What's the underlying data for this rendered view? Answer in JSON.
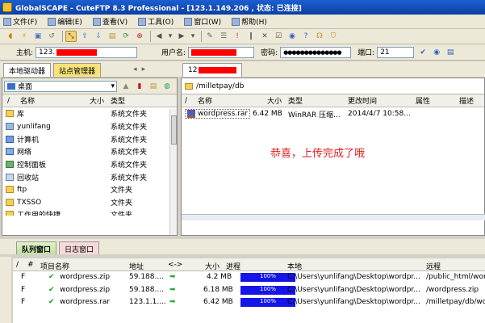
{
  "window": {
    "title": "GlobalSCAPE - CuteFTP 8.3 Professional - [123.1.149.206 , 状态: 已连接]"
  },
  "menu": [
    "文件(F)",
    "编辑(E)",
    "查看(V)",
    "工具(O)",
    "窗口(W)",
    "帮助(H)"
  ],
  "connection": {
    "host_label": "主机:",
    "host_value": "123.",
    "user_label": "用户名:",
    "pass_label": "密码:",
    "pass_value": "●●●●●●●●●●●●●●",
    "port_label": "端口:",
    "port_value": "21"
  },
  "left_tabs": [
    "本地驱动器",
    "站点管理器"
  ],
  "right_tab": "12",
  "local": {
    "path": "桌面",
    "columns": {
      "name": "名称",
      "size": "大小",
      "type": "类型"
    },
    "items": [
      {
        "name": "库",
        "type": "系统文件夹"
      },
      {
        "name": "yunlifang",
        "type": "系统文件夹"
      },
      {
        "name": "计算机",
        "type": "系统文件夹"
      },
      {
        "name": "网络",
        "type": "系统文件夹"
      },
      {
        "name": "控制面板",
        "type": "系统文件夹"
      },
      {
        "name": "回收站",
        "type": "系统文件夹"
      },
      {
        "name": "ftp",
        "type": "文件夹"
      },
      {
        "name": "TXSSO",
        "type": "文件夹"
      },
      {
        "name": "工作用的快捷",
        "type": "文件夹"
      }
    ]
  },
  "remote": {
    "path": "/milletpay/db",
    "columns": {
      "name": "名称",
      "size": "大小",
      "type": "类型",
      "modified": "更改时间",
      "attr": "属性",
      "desc": "描述"
    },
    "items": [
      {
        "name": "wordpress.rar",
        "size": "6.42 MB",
        "type": "WinRAR 压缩...",
        "modified": "2014/4/7 10:58..."
      }
    ]
  },
  "annotation": "恭喜，上传完成了哦",
  "queue_tabs": [
    "队列窗口",
    "日志窗口"
  ],
  "queue": {
    "columns": {
      "num": "#",
      "name": "项目名称",
      "address": "地址",
      "dir": "<->",
      "size": "大小",
      "progress": "进程",
      "local": "本地",
      "remote": "远程"
    },
    "rows": [
      {
        "type": "F",
        "name": "wordpress.zip",
        "address": "59.188....",
        "size": "4.2 MB",
        "progress": "100%",
        "progress_value": 1.0,
        "local": "C:\\Users\\yunlifang\\Desktop\\wordpr...",
        "remote": "/public_html/wor"
      },
      {
        "type": "F",
        "name": "wordpress.zip",
        "address": "59.188....",
        "size": "6.18 MB",
        "progress": "100%",
        "progress_value": 1.0,
        "local": "C:\\Users\\yunlifang\\Desktop\\wordpr...",
        "remote": "/wordpress.zip"
      },
      {
        "type": "F",
        "name": "wordpress.rar",
        "address": "123.1.1....",
        "size": "6.42 MB",
        "progress": "100%",
        "progress_value": 1.0,
        "local": "C:\\Users\\yunlifang\\Desktop\\wordpr...",
        "remote": "/milletpay/db/wo"
      }
    ]
  }
}
